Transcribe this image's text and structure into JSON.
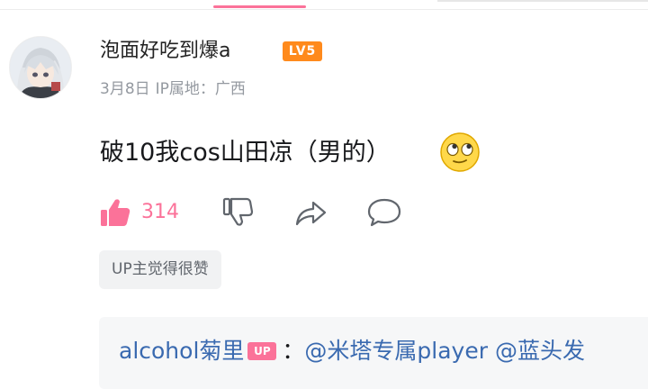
{
  "comment": {
    "username": "泡面好吃到爆a",
    "level_badge": "LV5",
    "date": "3月8日",
    "ip_location": "IP属地：广西",
    "text": "破10我cos山田凉（男的）",
    "emoji_icon": "rolling-eyes-emoji"
  },
  "actions": {
    "like_count": "314",
    "like_icon": "thumbs-up-icon",
    "dislike_icon": "thumbs-down-icon",
    "share_icon": "share-icon",
    "reply_icon": "comment-bubble-icon"
  },
  "up_liked_label": "UP主觉得很赞",
  "reply_preview": {
    "username": "alcohol菊里",
    "up_tag": "UP",
    "colon": "：",
    "mention1": "@米塔专属player",
    "mention2": "@蓝头发"
  },
  "colors": {
    "accent": "#fb7299",
    "level": "#ff8a1c",
    "link": "#3a6ab0",
    "muted": "#9499a0"
  }
}
